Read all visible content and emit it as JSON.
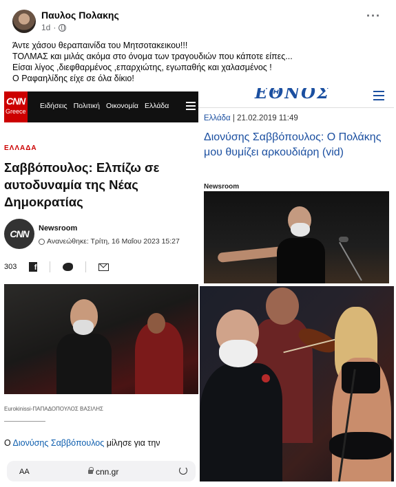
{
  "post": {
    "author": "Παυλος Πολακης",
    "time": "1d",
    "more": "···",
    "lines": [
      "Άντε χάσου θεραπαινίδα του Μητσοτακεικου!!!",
      "ΤΟΛΜΑΣ και μιλάς ακόμα στο όνομα των τραγουδιών που κάποτε είπες...",
      "Είσαι λίγος ,διεφθαρμένος ,επαρχιώτης, εγωπαθής και χαλασμένος !",
      "Ο Ραφαηλίδης είχε σε όλα δίκιο!"
    ]
  },
  "cnn": {
    "logo_line1": "CNN",
    "logo_line2": "Greece",
    "nav": [
      "Ειδήσεις",
      "Πολιτική",
      "Οικονομία",
      "Ελλάδα"
    ],
    "section": "ΕΛΛΑΔΑ",
    "title": "Σαββόπουλος: Ελπίζω σε αυτοδυναμία της Νέας Δημοκρατίας",
    "author_logo": "CNN",
    "author": "Newsroom",
    "updated": "Ανανεώθηκε: Τρίτη, 16 Μαΐου 2023 15:27",
    "shares": "303",
    "caption": "Eurokinissi-ΠΑΠΑΔΟΠΟΥΛΟΣ ΒΑΣΙΛΗΣ",
    "body_prefix": "Ο ",
    "body_link": "Διονύσης Σαββόπουλος",
    "body_suffix": " μίλησε για την",
    "browser_aa": "AA",
    "browser_url": "cnn.gr"
  },
  "ethnos": {
    "logo": "ΕΘΝΟΣ",
    "category": "Ελλάδα",
    "date": " | 21.02.2019 11:49",
    "title": "Διονύσης Σαββόπουλος: Ο Πολάκης μου θυμίζει αρκουδιάρη (vid)",
    "author": "Newsroom"
  }
}
